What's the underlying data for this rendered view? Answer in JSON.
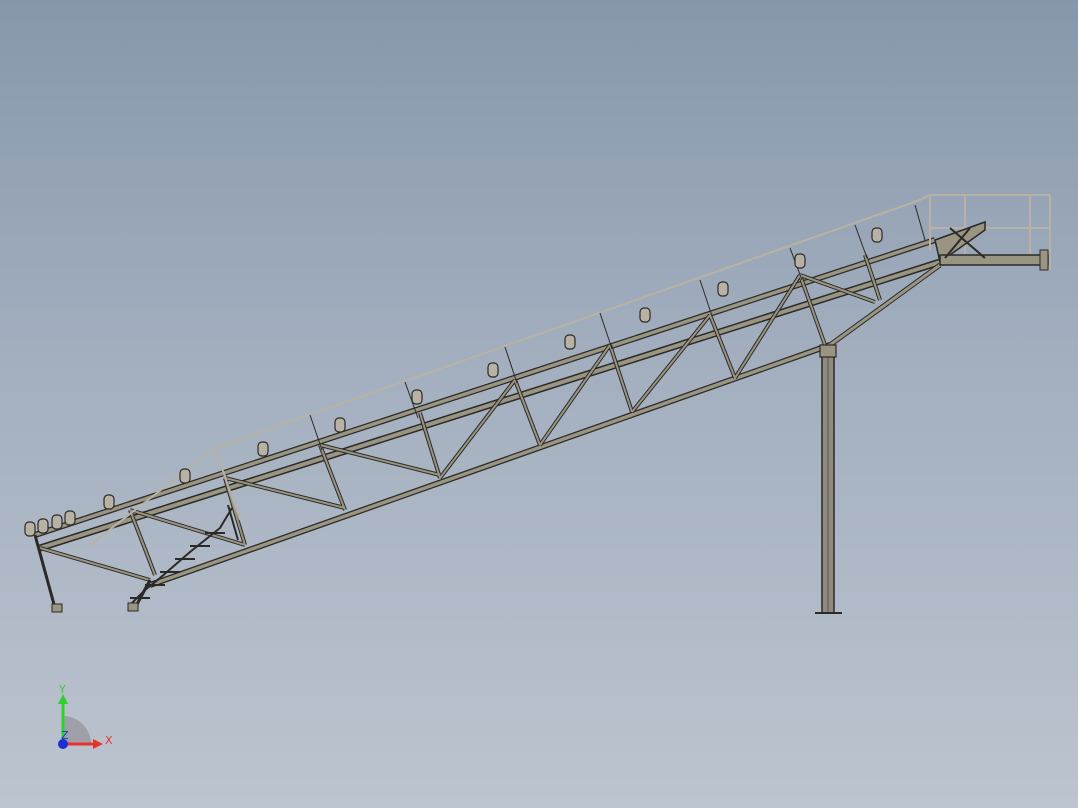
{
  "triad": {
    "x_label": "X",
    "y_label": "Y",
    "z_label": "Z",
    "x_color": "#e8322c",
    "y_color": "#2fd12f",
    "z_color": "#1f2fd6"
  },
  "model": {
    "member_color": "#9a9482",
    "edge_color": "#2b2a26",
    "rail_color": "#b8b2a4",
    "column_color": "#8e8a80"
  }
}
